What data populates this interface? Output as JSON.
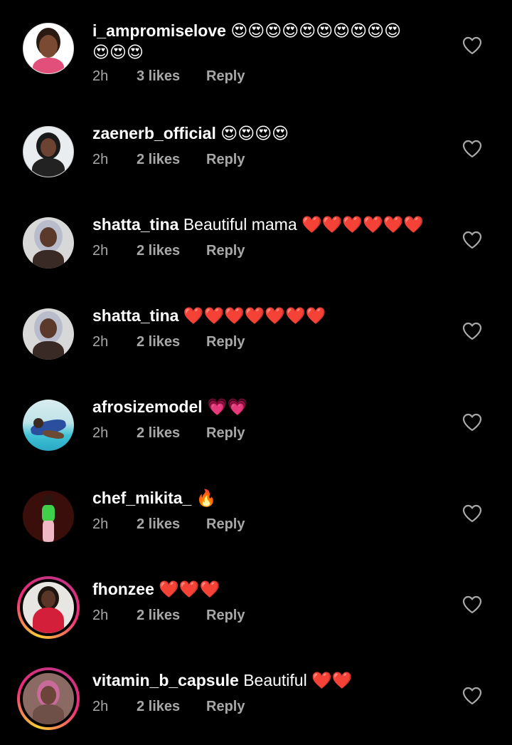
{
  "comments": [
    {
      "username": "i_ampromiselove",
      "text": "",
      "emojis_line1": "😍😍😍😍😍😍😍😍😍😍",
      "emojis_line2": "😍😍😍",
      "time": "2h",
      "likes": "3 likes",
      "reply": "Reply"
    },
    {
      "username": "zaenerb_official",
      "text": "",
      "emojis": "😍😍😍😍",
      "time": "2h",
      "likes": "2 likes",
      "reply": "Reply"
    },
    {
      "username": "shatta_tina",
      "text": "Beautiful mama",
      "emojis": "❤️❤️❤️❤️❤️❤️",
      "time": "2h",
      "likes": "2 likes",
      "reply": "Reply"
    },
    {
      "username": "shatta_tina",
      "text": "",
      "emojis": "❤️❤️❤️❤️❤️❤️❤️",
      "time": "2h",
      "likes": "2 likes",
      "reply": "Reply"
    },
    {
      "username": "afrosizemodel",
      "text": "",
      "emojis": "💗💗",
      "time": "2h",
      "likes": "2 likes",
      "reply": "Reply"
    },
    {
      "username": "chef_mikita_",
      "text": "",
      "emojis": "🔥",
      "time": "2h",
      "likes": "2 likes",
      "reply": "Reply"
    },
    {
      "username": "fhonzee",
      "text": "",
      "emojis": "❤️❤️❤️",
      "time": "2h",
      "likes": "2 likes",
      "reply": "Reply"
    },
    {
      "username": "vitamin_b_capsule",
      "text": "Beautiful",
      "emojis": "❤️❤️",
      "time": "2h",
      "likes": "2 likes",
      "reply": "Reply"
    }
  ],
  "icons": {
    "like": "heart-outline-icon"
  },
  "colors": {
    "background": "#000000",
    "text": "#ffffff",
    "meta_text": "#a8a8a8",
    "story_ring_start": "#f9ce34",
    "story_ring_end": "#ee2a7b"
  }
}
